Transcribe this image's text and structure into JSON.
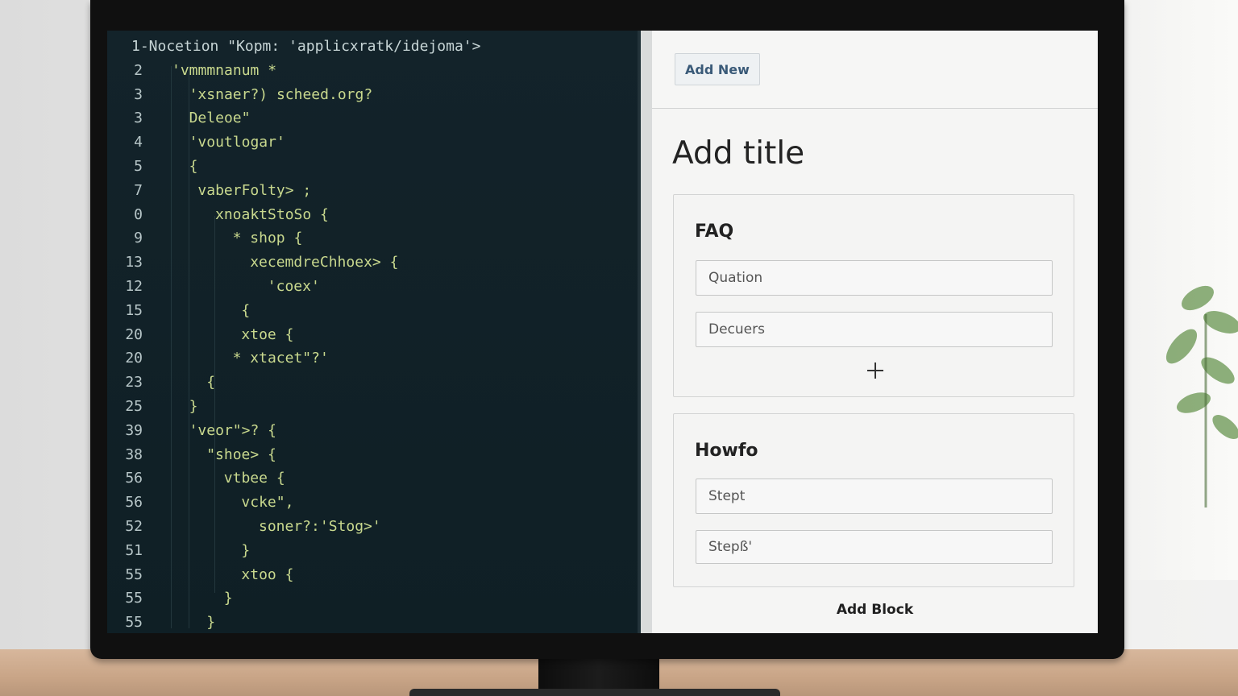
{
  "editor": {
    "lines": [
      {
        "num": "",
        "code": "1-Nocetion \"Kopm: 'applicxratk/idejoma'>",
        "indent": 0
      },
      {
        "num": "2",
        "code": "'vmmmnanum *",
        "indent": 0
      },
      {
        "num": "3",
        "code": "'xsnaer?) scheed.org?",
        "indent": 2
      },
      {
        "num": "3",
        "code": "Deleoe\"",
        "indent": 2
      },
      {
        "num": "4",
        "code": "'voutlogar'",
        "indent": 2
      },
      {
        "num": "5",
        "code": "{",
        "indent": 2
      },
      {
        "num": "7",
        "code": "vaberFolty> ;",
        "indent": 3
      },
      {
        "num": "0",
        "code": "xnoaktStoSo {",
        "indent": 5
      },
      {
        "num": "9",
        "code": "* shop {",
        "indent": 7
      },
      {
        "num": "13",
        "code": "xecemdreChhoex> {",
        "indent": 9
      },
      {
        "num": "12",
        "code": "'coex'",
        "indent": 11
      },
      {
        "num": "15",
        "code": "{",
        "indent": 8
      },
      {
        "num": "20",
        "code": "xtoe {",
        "indent": 8
      },
      {
        "num": "20",
        "code": "* xtacet\"?'",
        "indent": 7
      },
      {
        "num": "23",
        "code": "{",
        "indent": 4
      },
      {
        "num": "25",
        "code": "}",
        "indent": 2
      },
      {
        "num": "39",
        "code": "'veor\">? {",
        "indent": 2
      },
      {
        "num": "38",
        "code": "\"shoe> {",
        "indent": 4
      },
      {
        "num": "56",
        "code": "vtbee {",
        "indent": 6
      },
      {
        "num": "56",
        "code": "vcke\",",
        "indent": 8
      },
      {
        "num": "52",
        "code": "soner?:'Stog>'",
        "indent": 10
      },
      {
        "num": "51",
        "code": "}",
        "indent": 8
      },
      {
        "num": "55",
        "code": "xtoo {",
        "indent": 8
      },
      {
        "num": "55",
        "code": "}",
        "indent": 6
      },
      {
        "num": "55",
        "code": "}",
        "indent": 4
      }
    ]
  },
  "cms": {
    "add_new_label": "Add New",
    "page_title": "Add title",
    "faq_block": {
      "title": "FAQ",
      "question_placeholder": "Quation",
      "answer_placeholder": "Decuers"
    },
    "howto_block": {
      "title": "Howfo",
      "step1_placeholder": "Stept",
      "step2_placeholder": "Stepß'"
    },
    "add_block_label": "Add Block"
  },
  "colors": {
    "editor_bg": "#13232a",
    "code_text": "#c9d98e",
    "line_number": "#b7c6c8",
    "button_text": "#3a5a78"
  }
}
